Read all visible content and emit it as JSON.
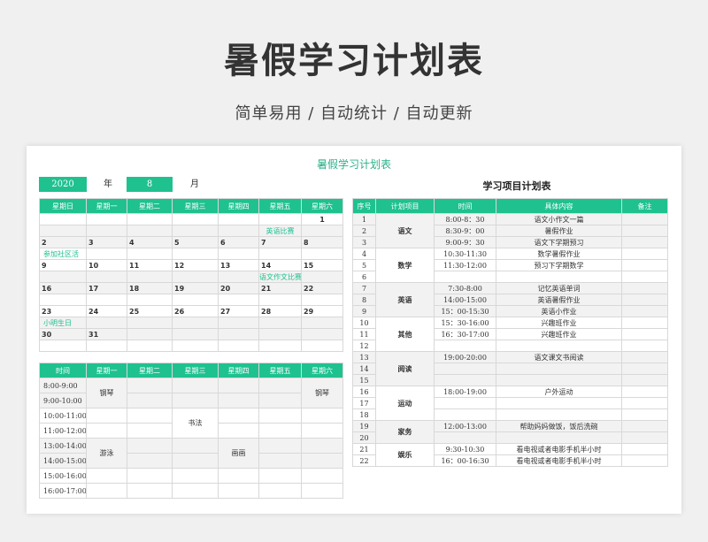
{
  "hero": {
    "title": "暑假学习计划表",
    "subtitle": "简单易用 / 自动统计 / 自动更新"
  },
  "sheet": {
    "title": "暑假学习计划表",
    "year": "2020",
    "year_label": "年",
    "month": "8",
    "month_label": "月",
    "plan_title": "学习项目计划表"
  },
  "calendar": {
    "headers": [
      "星期日",
      "星期一",
      "星期二",
      "星期三",
      "星期四",
      "星期五",
      "星期六"
    ],
    "weeks": [
      {
        "days": [
          "",
          "",
          "",
          "",
          "",
          "",
          "1"
        ],
        "events": [
          "",
          "",
          "",
          "",
          "",
          "英语比赛",
          ""
        ]
      },
      {
        "days": [
          "2",
          "3",
          "4",
          "5",
          "6",
          "7",
          "8"
        ],
        "events": [
          "参加社区活",
          "",
          "",
          "",
          "",
          "",
          ""
        ]
      },
      {
        "days": [
          "9",
          "10",
          "11",
          "12",
          "13",
          "14",
          "15"
        ],
        "events": [
          "",
          "",
          "",
          "",
          "",
          "语文作文比赛",
          ""
        ]
      },
      {
        "days": [
          "16",
          "17",
          "18",
          "19",
          "20",
          "21",
          "22"
        ],
        "events": [
          "",
          "",
          "",
          "",
          "",
          "",
          ""
        ]
      },
      {
        "days": [
          "23",
          "24",
          "25",
          "26",
          "27",
          "28",
          "29"
        ],
        "events": [
          "小明生日",
          "",
          "",
          "",
          "",
          "",
          ""
        ]
      },
      {
        "days": [
          "30",
          "31",
          "",
          "",
          "",
          "",
          ""
        ],
        "events": [
          "",
          "",
          "",
          "",
          "",
          "",
          ""
        ]
      }
    ]
  },
  "schedule": {
    "headers": [
      "时间",
      "星期一",
      "星期二",
      "星期三",
      "星期四",
      "星期五",
      "星期六"
    ],
    "times": [
      "8:00-9:00",
      "9:00-10:00",
      "10:00-11:00",
      "11:00-12:00",
      "13:00-14:00",
      "14:00-15:00",
      "15:00-16:00",
      "16:00-17:00"
    ],
    "activities": {
      "piano": "钢琴",
      "calligraphy": "书法",
      "swim": "游泳",
      "painting": "画画"
    }
  },
  "plan": {
    "headers": [
      "序号",
      "计划项目",
      "时间",
      "具体内容",
      "备注"
    ],
    "categories": [
      "语文",
      "数学",
      "英语",
      "其他",
      "阅读",
      "运动",
      "家务",
      "娱乐"
    ],
    "rows": [
      [
        "1",
        "8:00-8：30",
        "语文小作文一篇"
      ],
      [
        "2",
        "8:30-9：00",
        "暑假作业"
      ],
      [
        "3",
        "9:00-9：30",
        "语文下学期预习"
      ],
      [
        "4",
        "10:30-11:30",
        "数学暑假作业"
      ],
      [
        "5",
        "11:30-12:00",
        "预习下学期数学"
      ],
      [
        "6",
        "",
        ""
      ],
      [
        "7",
        "7:30-8:00",
        "记忆英语单词"
      ],
      [
        "8",
        "14:00-15:00",
        "英语暑假作业"
      ],
      [
        "9",
        "15：00-15:30",
        "英语小作业"
      ],
      [
        "10",
        "15：30-16:00",
        "兴趣班作业"
      ],
      [
        "11",
        "16：30-17:00",
        "兴趣班作业"
      ],
      [
        "12",
        "",
        ""
      ],
      [
        "13",
        "19:00-20:00",
        "语文课文书阅读"
      ],
      [
        "14",
        "",
        ""
      ],
      [
        "15",
        "",
        ""
      ],
      [
        "16",
        "18:00-19:00",
        "户外运动"
      ],
      [
        "17",
        "",
        ""
      ],
      [
        "18",
        "",
        ""
      ],
      [
        "19",
        "12:00-13:00",
        "帮助妈妈做饭，饭后洗碗"
      ],
      [
        "20",
        "",
        ""
      ],
      [
        "21",
        "9:30-10:30",
        "看电视或者电影手机半小时"
      ],
      [
        "22",
        "16：00-16:30",
        "看电视或者电影手机半小时"
      ]
    ]
  },
  "colors": {
    "accent": "#1fc18f",
    "title_green": "#2ab08a",
    "grey": "#f2f2f2"
  }
}
